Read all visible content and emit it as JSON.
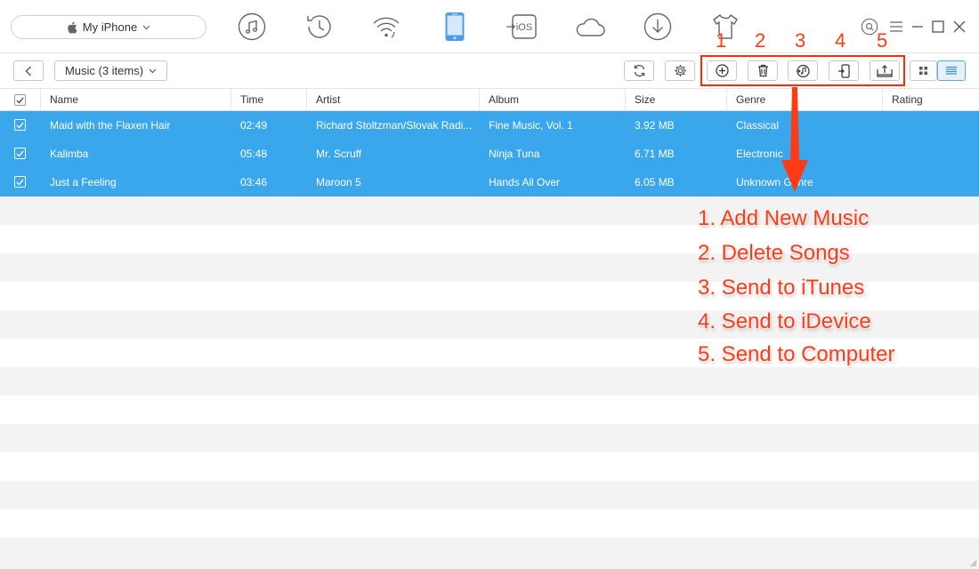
{
  "device": {
    "name": "My iPhone"
  },
  "nav": {
    "icons": [
      "music-icon",
      "history-icon",
      "wifi-sync-icon",
      "iphone-icon",
      "ios-mover-icon",
      "icloud-icon",
      "download-icon",
      "tshirt-icon"
    ],
    "active": "iphone-icon",
    "ios_label": "iOS"
  },
  "toolbar": {
    "category": "Music (3 items)"
  },
  "table": {
    "columns": [
      "Name",
      "Time",
      "Artist",
      "Album",
      "Size",
      "Genre",
      "Rating"
    ],
    "rows": [
      {
        "name": "Maid with the Flaxen Hair",
        "time": "02:49",
        "artist": "Richard Stoltzman/Slovak Radi...",
        "album": "Fine Music, Vol. 1",
        "size": "3.92 MB",
        "genre": "Classical",
        "rating": ""
      },
      {
        "name": "Kalimba",
        "time": "05:48",
        "artist": "Mr. Scruff",
        "album": "Ninja Tuna",
        "size": "6.71 MB",
        "genre": "Electronic",
        "rating": ""
      },
      {
        "name": "Just a Feeling",
        "time": "03:46",
        "artist": "Maroon 5",
        "album": "Hands All Over",
        "size": "6.05 MB",
        "genre": "Unknown Genre",
        "rating": ""
      }
    ]
  },
  "annotation": {
    "numbers": [
      "1",
      "2",
      "3",
      "4",
      "5"
    ],
    "lines": [
      "1. Add New Music",
      "2. Delete Songs",
      "3. Send to iTunes",
      "4. Send to iDevice",
      "5. Send to Computer"
    ]
  },
  "colors": {
    "selected_row": "#3aa6ec",
    "accent": "#3aa6ec",
    "annotation": "#ff3b16"
  }
}
